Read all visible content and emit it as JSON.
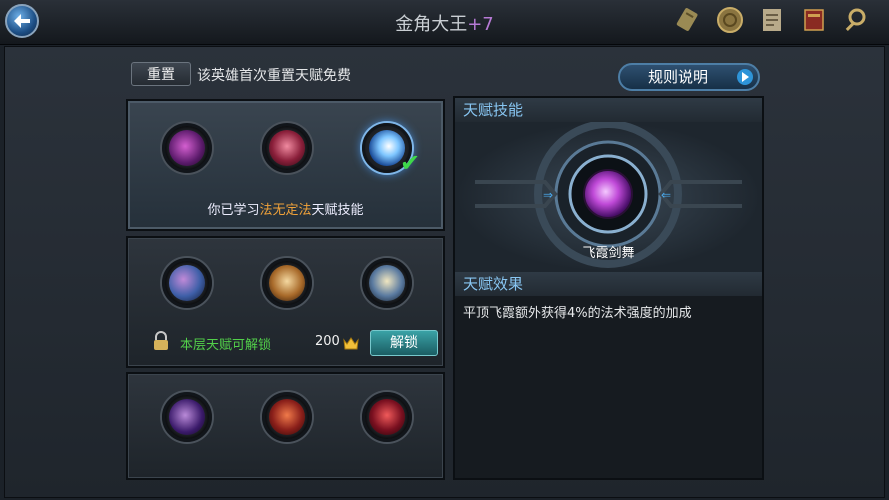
{
  "header": {
    "title": "金角大王",
    "title_level": "+7",
    "icons": [
      "scroll-icon",
      "coin-icon",
      "document-icon",
      "book-icon",
      "search-icon"
    ]
  },
  "toolbar": {
    "reset_label": "重置",
    "reset_note": "该英雄首次重置天赋免费",
    "rules_label": "规则说明"
  },
  "tiers": [
    {
      "skills": [
        "shadow-skill-icon",
        "blade-skill-icon",
        "lightning-skill-icon"
      ],
      "learned_prefix": "你已学习",
      "learned_skill": "法无定法",
      "learned_suffix": "天赋技能",
      "selected_index": 2
    },
    {
      "skills": [
        "wind-skill-icon",
        "strike-skill-icon",
        "sword-skill-icon"
      ],
      "lock_text": "本层天赋可解锁",
      "cost": "200",
      "unlock_label": "解锁"
    },
    {
      "skills": [
        "shadow-skill-icon",
        "fire-blade-skill-icon",
        "flame-bird-skill-icon"
      ]
    }
  ],
  "detail": {
    "skill_header": "天赋技能",
    "skill_name": "飞霞剑舞",
    "effect_header": "天赋效果",
    "effect_text": "平顶飞霞额外获得4%的法术强度的加成"
  },
  "colors": {
    "accent_blue": "#88c6f2",
    "learned_orange": "#f0a23a",
    "unlock_green": "#52d04a",
    "level_purple": "#b77ad6"
  }
}
